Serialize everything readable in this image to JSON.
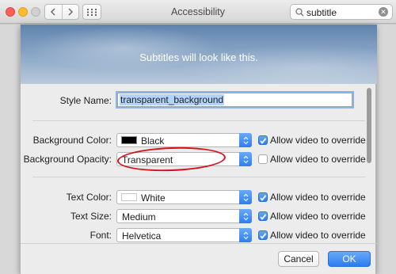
{
  "window": {
    "title": "Accessibility",
    "search_query": "subtitle"
  },
  "preview": {
    "text": "Subtitles will look like this."
  },
  "style_name": {
    "label": "Style Name:",
    "value": "transparent_background"
  },
  "background_color": {
    "label": "Background Color:",
    "value": "Black",
    "swatch_color": "#000000",
    "override_label": "Allow video to override",
    "override_checked": true
  },
  "background_opacity": {
    "label": "Background Opacity:",
    "value": "Transparent",
    "override_label": "Allow video to override",
    "override_checked": false
  },
  "text_color": {
    "label": "Text Color:",
    "value": "White",
    "swatch_color": "#ffffff",
    "override_label": "Allow video to override",
    "override_checked": true
  },
  "text_size": {
    "label": "Text Size:",
    "value": "Medium",
    "override_label": "Allow video to override",
    "override_checked": true
  },
  "font": {
    "label": "Font:",
    "value": "Helvetica",
    "override_label": "Allow video to override",
    "override_checked": true
  },
  "buttons": {
    "cancel": "Cancel",
    "ok": "OK"
  },
  "colors": {
    "accent": "#2d7ef1",
    "annotation": "#d3121a"
  }
}
